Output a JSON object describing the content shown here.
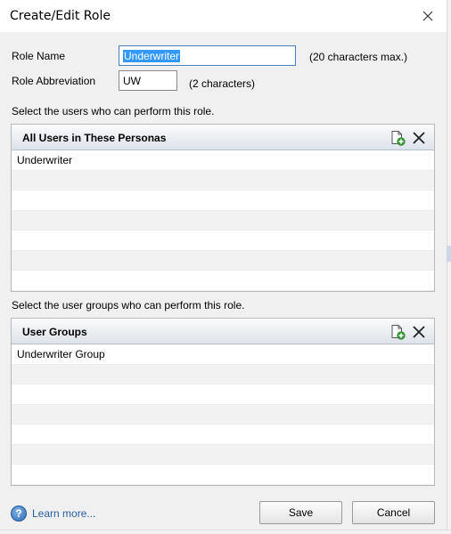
{
  "window": {
    "title": "Create/Edit Role"
  },
  "form": {
    "role_name_label": "Role Name",
    "role_name_value": "Underwriter",
    "role_name_hint": "(20 characters max.)",
    "abbrev_label": "Role Abbreviation",
    "abbrev_value": "UW",
    "abbrev_hint": "(2 characters)"
  },
  "users_section": {
    "instruction": "Select the users who can perform this role.",
    "header": "All Users in These Personas",
    "rows": [
      "Underwriter",
      "",
      "",
      "",
      "",
      "",
      ""
    ]
  },
  "groups_section": {
    "instruction": "Select the user groups who can perform this role.",
    "header": "User Groups",
    "rows": [
      "Underwriter Group",
      "",
      "",
      "",
      "",
      "",
      ""
    ]
  },
  "footer": {
    "help_glyph": "?",
    "help_label": "Learn more...",
    "save_label": "Save",
    "cancel_label": "Cancel"
  },
  "icons": {
    "close": "close-icon",
    "add": "add-document-icon",
    "remove": "delete-x-icon",
    "help": "help-icon"
  },
  "colors": {
    "selection": "#3399ff",
    "link": "#2a5d9f",
    "focus_border": "#4a7fc1",
    "add_icon_green": "#3aa13a"
  }
}
